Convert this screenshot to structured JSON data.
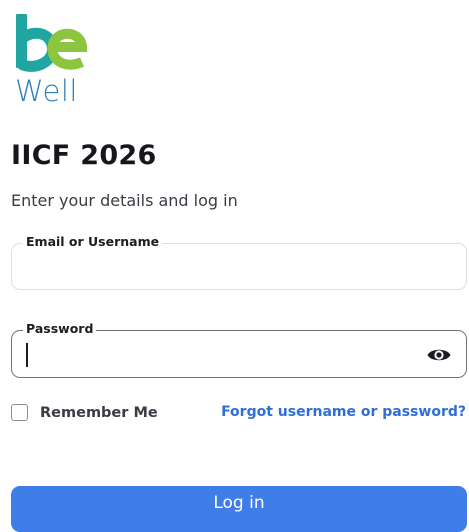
{
  "brand": {
    "logo_word": "Well",
    "colors": {
      "green": "#8cc63f",
      "teal": "#1fa6a0",
      "blue": "#2e7fb8"
    }
  },
  "header": {
    "title": "IICF 2026",
    "subtitle": "Enter your details and log in"
  },
  "form": {
    "email": {
      "label": "Email or Username",
      "value": "",
      "placeholder": ""
    },
    "password": {
      "label": "Password",
      "value": "",
      "placeholder": "",
      "toggle_icon": "eye-icon"
    },
    "remember": {
      "label": "Remember Me",
      "checked": false
    },
    "forgot_link": "Forgot username or password?",
    "submit_label": "Log in"
  },
  "colors": {
    "accent": "#3f7ee8",
    "link": "#2e6fd6"
  }
}
